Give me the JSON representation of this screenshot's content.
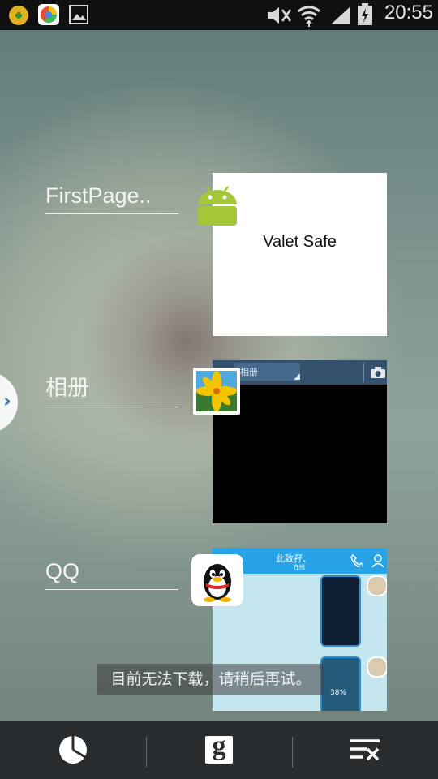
{
  "status_bar": {
    "time": "20:55",
    "left_icons": [
      "notification-app-icon",
      "browser-icon",
      "gallery-icon"
    ],
    "right_icons": [
      "mute-icon",
      "wifi-icon",
      "signal-icon",
      "battery-icon"
    ]
  },
  "recent_apps": [
    {
      "label": "FirstPage..",
      "icon": "android-icon",
      "thumbnail_text": "Valet Safe"
    },
    {
      "label": "相册",
      "icon": "gallery-app-icon",
      "thumbnail_text": "相册"
    },
    {
      "label": "QQ",
      "icon": "qq-penguin-icon",
      "thumbnail_text": "此致孖、",
      "thumbnail_subtext": "在线",
      "thumbnail_badge": "38%"
    }
  ],
  "toast": "目前无法下载，请稍后再试。",
  "bottom_bar": {
    "buttons": [
      "task-manager-icon",
      "google-search-icon",
      "close-all-icon"
    ],
    "google_letter": "g"
  },
  "colors": {
    "status_bar": "#101010",
    "bottom_bar": "#2a2d30",
    "android_green": "#a4c639",
    "qq_blue": "#29a3e8"
  }
}
